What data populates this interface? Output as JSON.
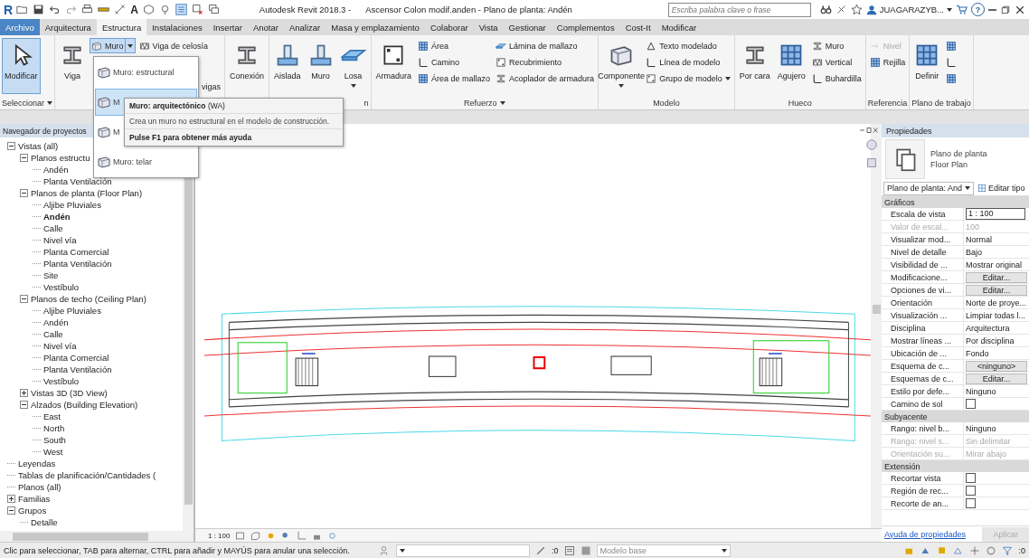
{
  "title_bar": {
    "app_logo": "R",
    "text_tool": "A",
    "app_title": "Autodesk Revit 2018.3 -",
    "document_title": "Ascensor Colon modif.anden - Plano de planta: Andén",
    "search": {
      "placeholder": "Escriba palabra clave o frase"
    },
    "user": "JUAGARAZYB...",
    "help": "?"
  },
  "tabs": [
    {
      "label": "Archivo",
      "kind": "file",
      "selected": false
    },
    {
      "label": "Arquitectura",
      "kind": "tab",
      "selected": false
    },
    {
      "label": "Estructura",
      "kind": "tab",
      "selected": true
    },
    {
      "label": "Instalaciones",
      "kind": "tab",
      "selected": false
    },
    {
      "label": "Insertar",
      "kind": "tab",
      "selected": false
    },
    {
      "label": "Anotar",
      "kind": "tab",
      "selected": false
    },
    {
      "label": "Analizar",
      "kind": "tab",
      "selected": false
    },
    {
      "label": "Masa y emplazamiento",
      "kind": "tab",
      "selected": false
    },
    {
      "label": "Colaborar",
      "kind": "tab",
      "selected": false
    },
    {
      "label": "Vista",
      "kind": "tab",
      "selected": false
    },
    {
      "label": "Gestionar",
      "kind": "tab",
      "selected": false
    },
    {
      "label": "Complementos",
      "kind": "tab",
      "selected": false
    },
    {
      "label": "Cost-It",
      "kind": "tab",
      "selected": false
    },
    {
      "label": "Modificar",
      "kind": "tab",
      "selected": false
    }
  ],
  "ribbon": {
    "panels": [
      {
        "title": "Seleccionar",
        "menu": true,
        "columns": [
          [
            {
              "label": "Modificar",
              "kind": "large",
              "active": true,
              "disabled": false
            }
          ]
        ]
      },
      {
        "columns": [
          [
            {
              "label": "Viga",
              "kind": "large",
              "active": false,
              "disabled": false
            }
          ],
          [
            {
              "label": "Muro",
              "kind": "split",
              "active": true,
              "disabled": false
            }
          ],
          [
            {
              "label": "Viga de celosía",
              "kind": "small",
              "active": false,
              "disabled": false
            },
            {
              "label": "vigas",
              "kind": "text",
              "active": false,
              "disabled": false
            }
          ]
        ]
      },
      {
        "columns": [
          [
            {
              "label": "Conexión",
              "kind": "large",
              "active": false,
              "disabled": false
            }
          ]
        ]
      },
      {
        "title": "n",
        "columns": [
          [
            {
              "label": "Aislada",
              "kind": "large",
              "active": false,
              "disabled": false
            }
          ],
          [
            {
              "label": "Muro",
              "kind": "large",
              "active": false,
              "disabled": false
            }
          ],
          [
            {
              "label": "Losa",
              "kind": "large",
              "caret": true,
              "active": false,
              "disabled": false
            }
          ]
        ]
      },
      {
        "title": "Refuerzo",
        "menu": true,
        "columns": [
          [
            {
              "label": "Armadura",
              "kind": "large",
              "active": false,
              "disabled": false
            }
          ],
          [
            {
              "label": "Área",
              "kind": "small",
              "active": false,
              "disabled": false
            },
            {
              "label": "Camino",
              "kind": "small",
              "active": false,
              "disabled": false
            },
            {
              "label": "Área de mallazo",
              "kind": "small",
              "active": false,
              "disabled": false
            }
          ],
          [
            {
              "label": "Lámina de mallazo",
              "kind": "small",
              "active": false,
              "disabled": false
            },
            {
              "label": "Recubrimiento",
              "kind": "small",
              "active": false,
              "disabled": false
            },
            {
              "label": "Acoplador de armadura",
              "kind": "small",
              "active": false,
              "disabled": false
            }
          ]
        ]
      },
      {
        "title": "Modelo",
        "columns": [
          [
            {
              "label": "Componente",
              "kind": "large",
              "caret": true,
              "active": false,
              "disabled": false
            }
          ],
          [
            {
              "label": "Texto modelado",
              "kind": "small",
              "active": false,
              "disabled": false
            },
            {
              "label": "Línea de modelo",
              "kind": "small",
              "active": false,
              "disabled": false
            },
            {
              "label": "Grupo de modelo",
              "kind": "small",
              "caret": true,
              "active": false,
              "disabled": false
            }
          ]
        ]
      },
      {
        "title": "Hueco",
        "columns": [
          [
            {
              "label": "Por cara",
              "kind": "large",
              "active": false,
              "disabled": false
            }
          ],
          [
            {
              "label": "Agujero",
              "kind": "large",
              "active": false,
              "disabled": false
            }
          ],
          [
            {
              "label": "Muro",
              "kind": "small",
              "active": false,
              "disabled": false
            },
            {
              "label": "Vertical",
              "kind": "small",
              "active": false,
              "disabled": false
            },
            {
              "label": "Buhardilla",
              "kind": "small",
              "active": false,
              "disabled": false
            }
          ]
        ]
      },
      {
        "title": "Referencia",
        "columns": [
          [
            {
              "label": "Nivel",
              "kind": "small",
              "active": false,
              "disabled": true
            },
            {
              "label": "Rejilla",
              "kind": "small",
              "active": false,
              "disabled": false
            }
          ]
        ]
      },
      {
        "title": "Plano de trabajo",
        "columns": [
          [
            {
              "label": "Definir",
              "kind": "large",
              "active": false,
              "disabled": false
            }
          ],
          [
            {
              "kind": "icon",
              "active": false,
              "disabled": false
            },
            {
              "kind": "icon",
              "active": false,
              "disabled": false
            },
            {
              "kind": "icon",
              "active": false,
              "disabled": false
            }
          ]
        ]
      }
    ]
  },
  "wall_menu": {
    "items": [
      {
        "label": "Muro: estructural",
        "selected": false
      },
      {
        "label": "M",
        "selected": true
      },
      {
        "label": "M",
        "selected": false
      },
      {
        "label": "Muro: telar",
        "selected": false
      }
    ]
  },
  "tooltip": {
    "title": "**Muro: arquitectónico** (WA)",
    "description": "Crea un muro no estructural en el modelo de construcción.",
    "help": "Pulse F1 para obtener más ayuda"
  },
  "navigator": {
    "title": "Navegador de proyectos",
    "tree": [
      {
        "label": "Vistas (all)",
        "expanded": true,
        "selected": false,
        "children": [
          {
            "label": "Planos estructu",
            "expanded": true,
            "selected": false,
            "children": [
              {
                "label": "Andén",
                "selected": false
              },
              {
                "label": "Planta Ventilación",
                "selected": false
              }
            ]
          },
          {
            "label": "Planos de planta (Floor Plan)",
            "expanded": true,
            "selected": false,
            "children": [
              {
                "label": "Aljibe Pluviales",
                "selected": false
              },
              {
                "label": "Andén",
                "selected": true
              },
              {
                "label": "Calle",
                "selected": false
              },
              {
                "label": "Nivel vía",
                "selected": false
              },
              {
                "label": "Planta Comercial",
                "selected": false
              },
              {
                "label": "Planta Ventilación",
                "selected": false
              },
              {
                "label": "Site",
                "selected": false
              },
              {
                "label": "Vestíbulo",
                "selected": false
              }
            ]
          },
          {
            "label": "Planos de techo (Ceiling Plan)",
            "expanded": true,
            "selected": false,
            "children": [
              {
                "label": "Aljibe Pluviales",
                "selected": false
              },
              {
                "label": "Andén",
                "selected": false
              },
              {
                "label": "Calle",
                "selected": false
              },
              {
                "label": "Nivel vía",
                "selected": false
              },
              {
                "label": "Planta Comercial",
                "selected": false
              },
              {
                "label": "Planta Ventilación",
                "selected": false
              },
              {
                "label": "Vestíbulo",
                "selected": false
              }
            ]
          },
          {
            "label": "Vistas 3D (3D View)",
            "expanded": false,
            "selected": false
          },
          {
            "label": "Alzados (Building Elevation)",
            "expanded": true,
            "selected": false,
            "children": [
              {
                "label": "East",
                "selected": false
              },
              {
                "label": "North",
                "selected": false
              },
              {
                "label": "South",
                "selected": false
              },
              {
                "label": "West",
                "selected": false
              }
            ]
          }
        ]
      },
      {
        "label": "Leyendas",
        "selected": false
      },
      {
        "label": "Tablas de planificación/Cantidades (",
        "selected": false
      },
      {
        "label": "Planos (all)",
        "selected": false
      },
      {
        "label": "Familias",
        "expanded": false,
        "selected": false
      },
      {
        "label": "Grupos",
        "expanded": true,
        "selected": false,
        "children": [
          {
            "label": "Detalle",
            "selected": false
          }
        ]
      }
    ]
  },
  "view_bar": {
    "scale": "1 : 100"
  },
  "properties": {
    "title": "Propiedades",
    "type_name": "Plano de planta",
    "type_subname": "Floor Plan",
    "view_selector": "Plano de planta: And",
    "edit_type": "Editar tipo",
    "groups": [
      {
        "name": "Gráficos",
        "rows": [
          {
            "label": "Escala de vista",
            "value": "1 : 100",
            "kind": "input"
          },
          {
            "label": "Valor de escal...",
            "value": "100",
            "kind": "disabled"
          },
          {
            "label": "Visualizar mod...",
            "value": "Normal",
            "kind": "text"
          },
          {
            "label": "Nivel de detalle",
            "value": "Bajo",
            "kind": "text"
          },
          {
            "label": "Visibilidad de ...",
            "value": "Mostrar original",
            "kind": "text"
          },
          {
            "label": "Modificacione...",
            "value": "Editar...",
            "kind": "button"
          },
          {
            "label": "Opciones de vi...",
            "value": "Editar...",
            "kind": "button"
          },
          {
            "label": "Orientación",
            "value": "Norte de proye...",
            "kind": "text"
          },
          {
            "label": "Visualización ...",
            "value": "Limpiar todas l...",
            "kind": "text"
          },
          {
            "label": "Disciplina",
            "value": "Arquitectura",
            "kind": "text"
          },
          {
            "label": "Mostrar líneas ...",
            "value": "Por disciplina",
            "kind": "text"
          },
          {
            "label": "Ubicación de ...",
            "value": "Fondo",
            "kind": "text"
          },
          {
            "label": "Esquema de c...",
            "value": "<ninguno>",
            "kind": "button"
          },
          {
            "label": "Esquemas de c...",
            "value": "Editar...",
            "kind": "button"
          },
          {
            "label": "Estilo por defe...",
            "value": "Ninguno",
            "kind": "text"
          },
          {
            "label": "Camino de sol",
            "kind": "checkbox",
            "checked": false
          }
        ]
      },
      {
        "name": "Subyacente",
        "rows": [
          {
            "label": "Rango: nivel b...",
            "value": "Ninguno",
            "kind": "text"
          },
          {
            "label": "Rango: nivel s...",
            "value": "Sin delimitar",
            "kind": "disabled"
          },
          {
            "label": "Orientación su...",
            "value": "Mirar abajo",
            "kind": "disabled"
          }
        ]
      },
      {
        "name": "Extensión",
        "rows": [
          {
            "label": "Recortar vista",
            "kind": "checkbox",
            "checked": false
          },
          {
            "label": "Región de rec...",
            "kind": "checkbox",
            "checked": false
          },
          {
            "label": "Recorte de an...",
            "kind": "checkbox",
            "checked": false
          }
        ]
      }
    ],
    "help_link": "Ayuda de propiedades",
    "apply_button": {
      "label": "Aplicar",
      "disabled": true
    }
  },
  "status_bar": {
    "message": "Clic para seleccionar, TAB para alternar, CTRL para añadir y MAYÚS para anular una selección.",
    "editable_count": ":0",
    "active_model": "Modelo base",
    "filter_count": ":0"
  }
}
